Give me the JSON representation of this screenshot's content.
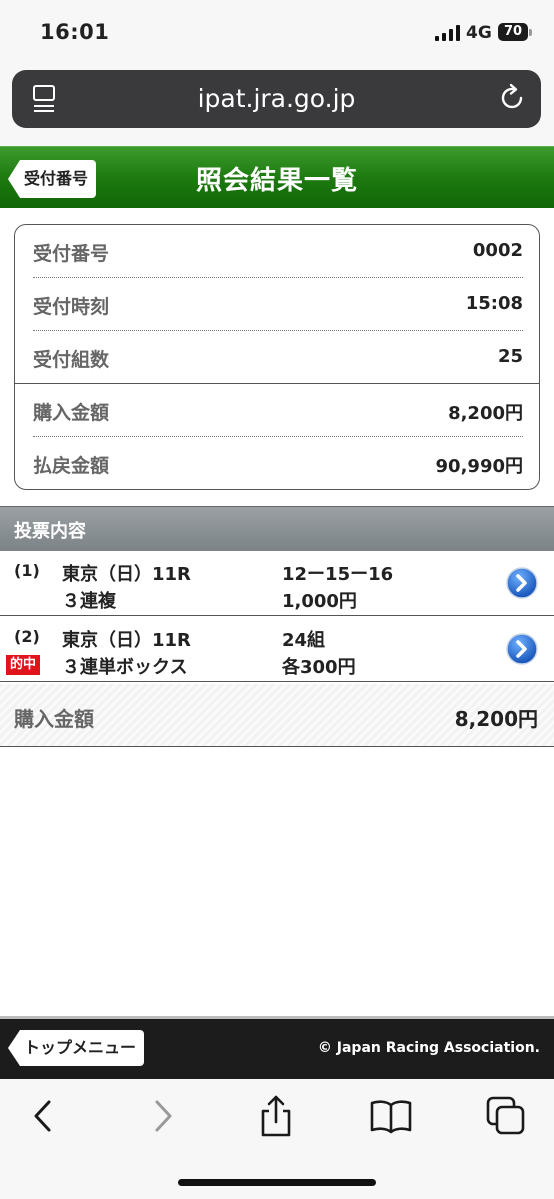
{
  "status": {
    "time": "16:01",
    "network": "4G",
    "battery": "70"
  },
  "browser": {
    "url": "ipat.jra.go.jp"
  },
  "header": {
    "back_label": "受付番号",
    "title": "照会結果一覧"
  },
  "receipt": {
    "rows": [
      {
        "label": "受付番号",
        "value": "0002"
      },
      {
        "label": "受付時刻",
        "value": "15:08"
      },
      {
        "label": "受付組数",
        "value": "25"
      },
      {
        "label": "購入金額",
        "value": "8,200円"
      },
      {
        "label": "払戻金額",
        "value": "90,990円"
      }
    ]
  },
  "votes": {
    "header": "投票内容",
    "items": [
      {
        "num": "(1)",
        "venue": "東京（日）11R",
        "kind": "３連複",
        "combo": "12ー15ー16",
        "amount": "1,000円",
        "hit": ""
      },
      {
        "num": "(2)",
        "venue": "東京（日）11R",
        "kind": "３連単ボックス",
        "combo": "24組",
        "amount": "各300円",
        "hit": "的中"
      }
    ],
    "total_label": "購入金額",
    "total_value": "8,200円"
  },
  "footer": {
    "top_menu": "トップメニュー",
    "copyright": "© Japan Racing Association."
  },
  "colors": {
    "header_green": "#1e7a10",
    "hit_red": "#e0141b",
    "arrow_blue": "#1f6fd1"
  }
}
